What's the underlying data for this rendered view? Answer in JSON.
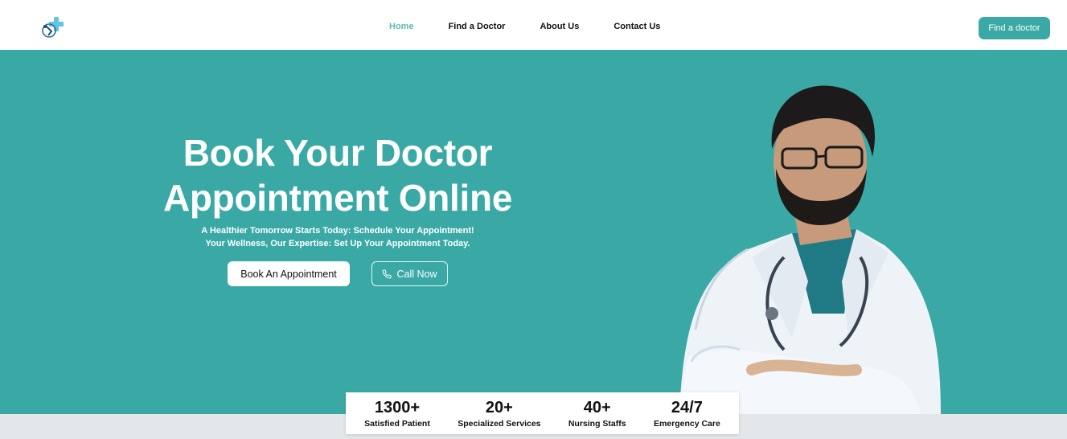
{
  "nav": {
    "logo_icon": "medical-cross-logo-icon",
    "links": [
      {
        "label": "Home",
        "active": true
      },
      {
        "label": "Find a Doctor",
        "active": false
      },
      {
        "label": "About Us",
        "active": false
      },
      {
        "label": "Contact Us",
        "active": false
      }
    ],
    "cta_label": "Find a doctor"
  },
  "hero": {
    "title_line1": "Book Your Doctor",
    "title_line2": "Appointment Online",
    "subtitle_line1": "A Healthier Tomorrow Starts Today: Schedule Your Appointment!",
    "subtitle_line2": "Your Wellness, Our Expertise: Set Up Your Appointment Today.",
    "book_label": "Book An Appointment",
    "call_label": "Call Now",
    "call_icon": "phone-icon",
    "image": "doctor-portrait"
  },
  "stats": [
    {
      "value": "1300+",
      "label": "Satisfied Patient"
    },
    {
      "value": "20+",
      "label": "Specialized Services"
    },
    {
      "value": "40+",
      "label": "Nursing Staffs"
    },
    {
      "value": "24/7",
      "label": "Emergency Care"
    }
  ],
  "colors": {
    "primary": "#3aa9a6",
    "active_link": "#5fb9b4",
    "page_bg": "#e4e7e9"
  }
}
